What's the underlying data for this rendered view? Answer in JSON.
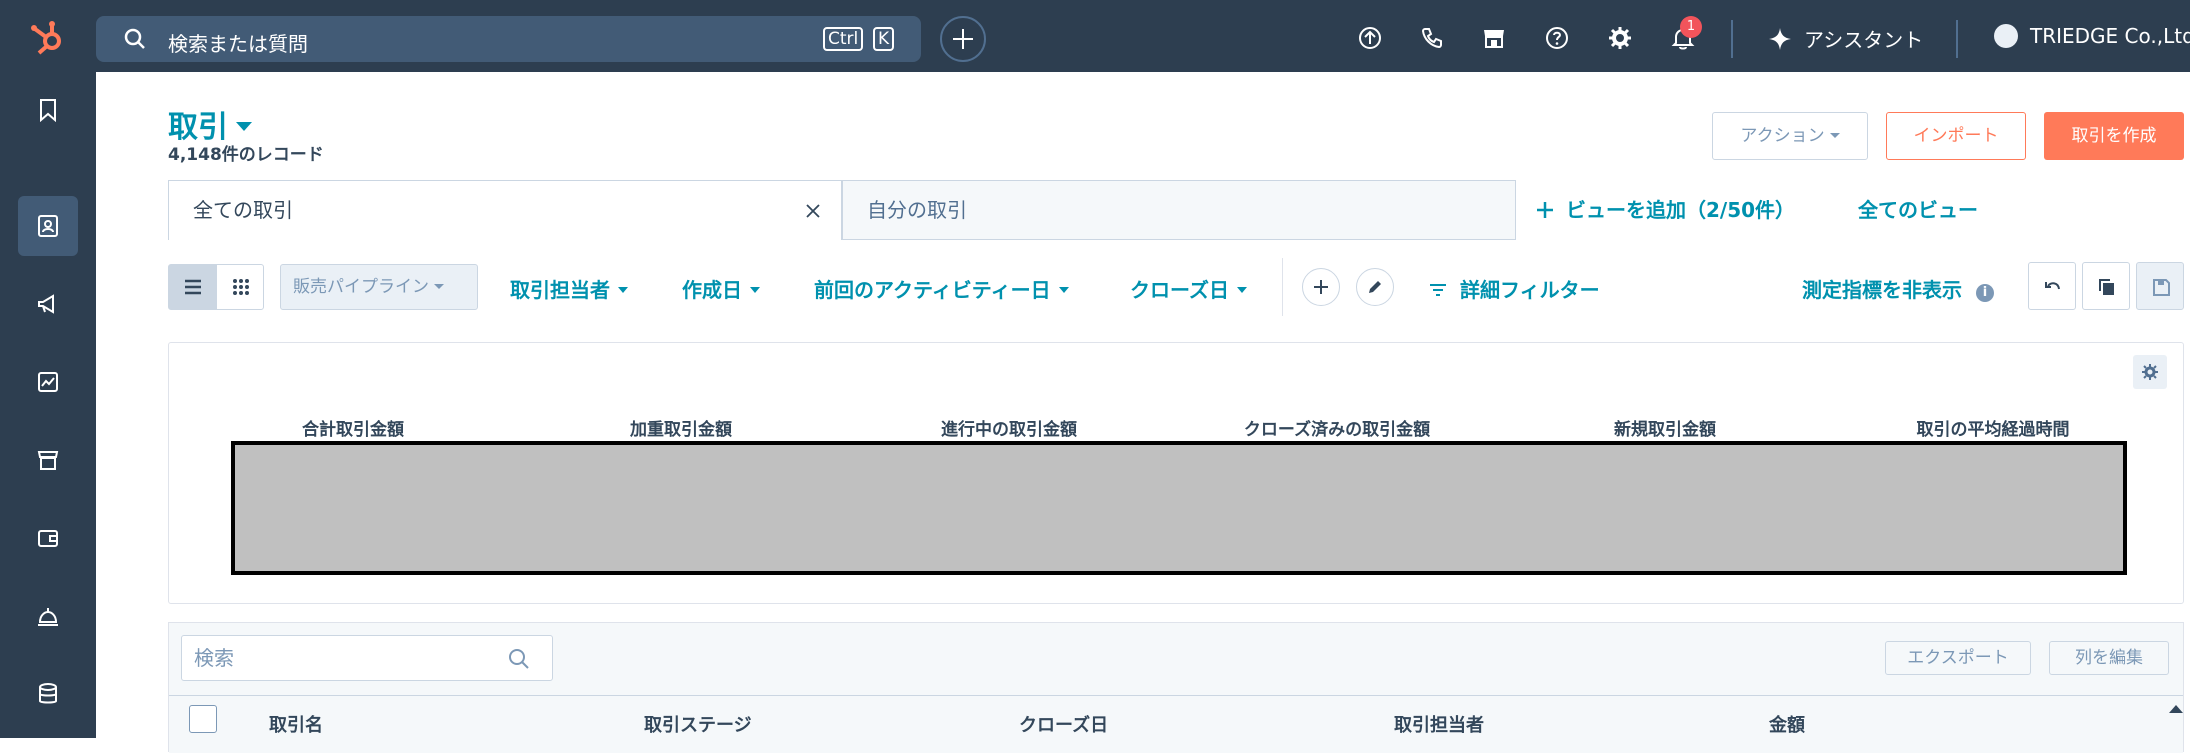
{
  "topbar": {
    "search_placeholder": "検索または質問",
    "shortcut_ctrl": "Ctrl",
    "shortcut_k": "K",
    "notification_count": "1",
    "assistant_label": "アシスタント",
    "account_name": "TRIEDGE Co.,Ltd"
  },
  "header": {
    "title": "取引",
    "record_count": "4,148件のレコード",
    "action_label": "アクション",
    "import_label": "インポート",
    "create_label": "取引を作成"
  },
  "views": {
    "tabs": [
      {
        "label": "全ての取引"
      },
      {
        "label": "自分の取引"
      }
    ],
    "add_view_label": "ビューを追加（2/50件）",
    "all_views_label": "全てのビュー"
  },
  "filters": {
    "pipeline_label": "販売パイプライン",
    "items": [
      "取引担当者",
      "作成日",
      "前回のアクティビティー日",
      "クローズ日"
    ],
    "advanced_label": "詳細フィルター",
    "hide_metrics_label": "測定指標を非表示"
  },
  "metrics": {
    "labels": [
      "合計取引金額",
      "加重取引金額",
      "進行中の取引金額",
      "クローズ済みの取引金額",
      "新規取引金額",
      "取引の平均経過時間"
    ]
  },
  "table": {
    "search_placeholder": "検索",
    "export_label": "エクスポート",
    "edit_columns_label": "列を編集",
    "columns": [
      "取引名",
      "取引ステージ",
      "クローズ日",
      "取引担当者",
      "金額"
    ]
  },
  "colors": {
    "nav_bg": "#2d3e50",
    "accent": "#0091ae",
    "primary_button": "#ff7a59"
  }
}
